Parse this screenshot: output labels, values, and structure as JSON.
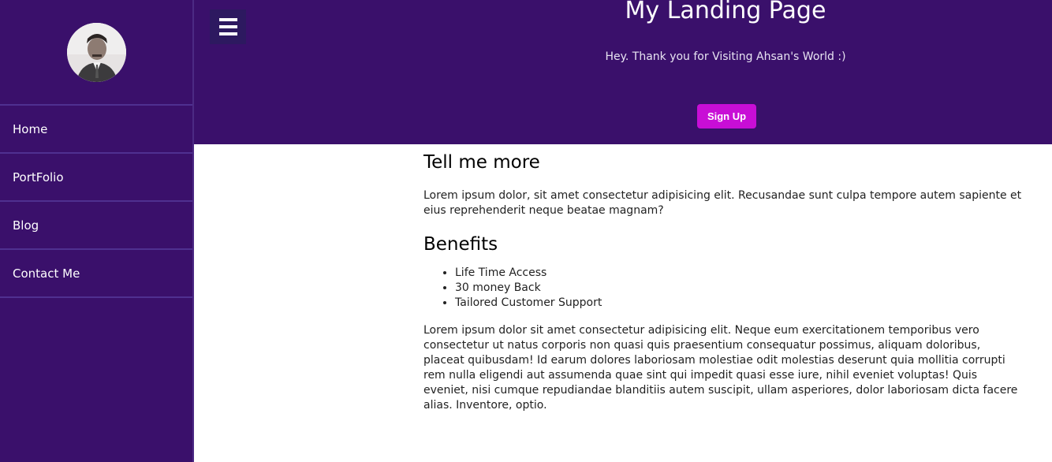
{
  "sidebar": {
    "avatar_alt": "profile photo",
    "items": [
      {
        "label": "Home"
      },
      {
        "label": "PortFolio"
      },
      {
        "label": "Blog"
      },
      {
        "label": "Contact Me"
      }
    ]
  },
  "header": {
    "menu_icon": "hamburger-icon",
    "title": "My Landing Page",
    "subtitle": "Hey. Thank you for Visiting Ahsan's World :)",
    "signup_label": "Sign Up"
  },
  "main": {
    "section1_heading": "Tell me more",
    "section1_text": "Lorem ipsum dolor, sit amet consectetur adipisicing elit. Recusandae sunt culpa tempore autem sapiente et eius reprehenderit neque beatae magnam?",
    "section2_heading": "Benefits",
    "benefits": [
      "Life Time Access",
      "30 money Back",
      "Tailored Customer Support"
    ],
    "section2_text": "Lorem ipsum dolor sit amet consectetur adipisicing elit. Neque eum exercitationem temporibus vero consectetur ut natus corporis non quasi quis praesentium consequatur possimus, aliquam doloribus, placeat quibusdam! Id earum dolores laboriosam molestiae odit molestias deserunt quia mollitia corrupti rem nulla eligendi aut assumenda quae sint qui impedit quasi esse iure, nihil eveniet voluptas! Quis eveniet, nisi cumque repudiandae blanditiis autem suscipit, ullam asperiores, dolor laboriosam dicta facere alias. Inventore, optio."
  },
  "colors": {
    "sidebar_bg": "#3a106b",
    "header_bg": "#3a106b",
    "accent_button": "#c80ed6"
  }
}
